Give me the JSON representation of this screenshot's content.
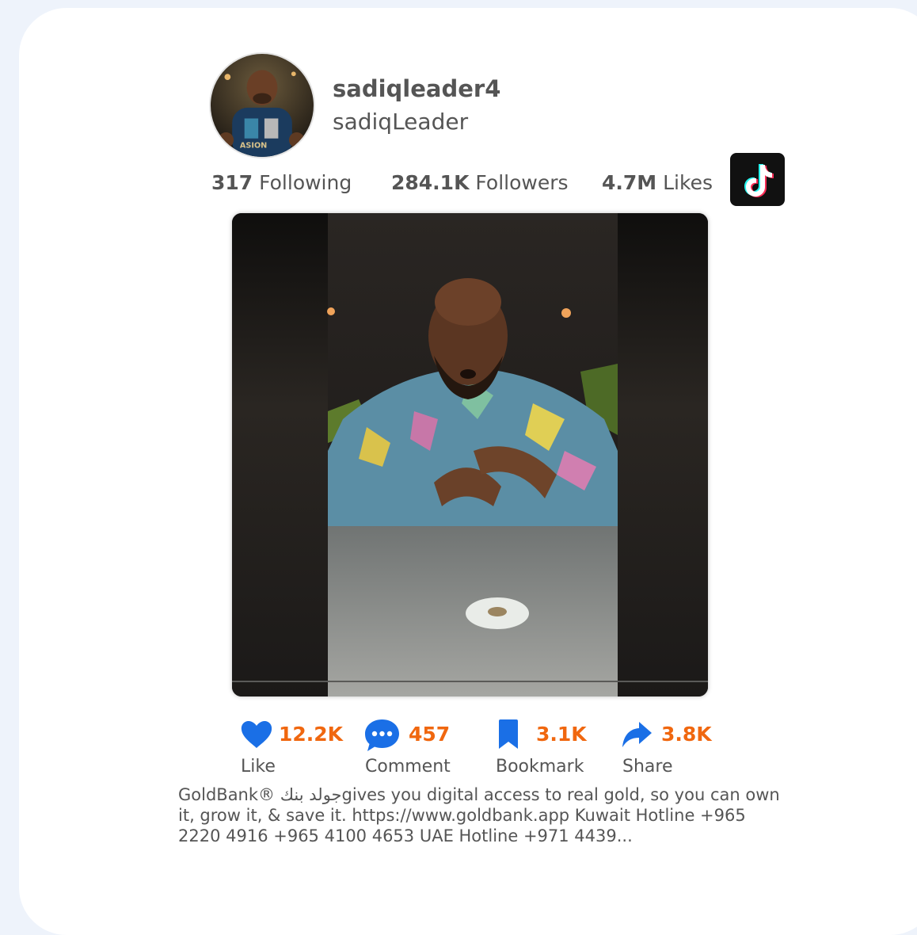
{
  "profile": {
    "username": "sadiqleader4",
    "display_name": "sadiqLeader",
    "avatar_icon": "profile-photo"
  },
  "stats": {
    "following_value": "317",
    "following_label": "Following",
    "followers_value": "284.1K",
    "followers_label": "Followers",
    "likes_value": "4.7M",
    "likes_label": "Likes"
  },
  "platform": {
    "icon": "tiktok-logo-icon"
  },
  "video": {
    "thumbnail": "video-thumbnail"
  },
  "actions": {
    "like": {
      "count": "12.2K",
      "label": "Like",
      "icon": "heart-icon"
    },
    "comment": {
      "count": "457",
      "label": "Comment",
      "icon": "comment-bubble-icon"
    },
    "bookmark": {
      "count": "3.1K",
      "label": "Bookmark",
      "icon": "bookmark-icon"
    },
    "share": {
      "count": "3.8K",
      "label": "Share",
      "icon": "share-arrow-icon"
    }
  },
  "caption": {
    "text": "GoldBank® جولد بنكgives you digital access to real gold, so you can own it, grow it, & save it. https://www.goldbank.app Kuwait Hotline +965 2220 4916 +965 4100 4653 UAE Hotline +971 4439..."
  },
  "colors": {
    "background": "#eef3fb",
    "card": "#ffffff",
    "text": "#555555",
    "count_accent": "#f0670f",
    "icon_blue": "#1a6fe6",
    "tiktok_bg": "#111111"
  }
}
